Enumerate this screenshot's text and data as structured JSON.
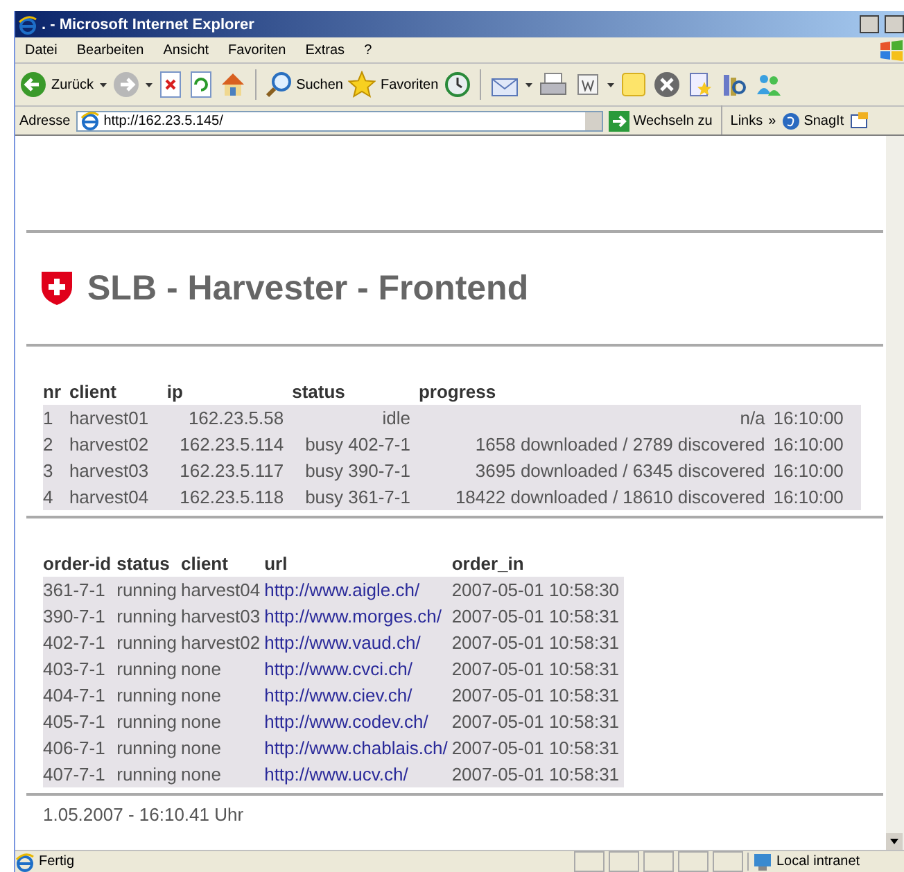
{
  "window": {
    "title": ". - Microsoft Internet Explorer"
  },
  "menu": [
    "Datei",
    "Bearbeiten",
    "Ansicht",
    "Favoriten",
    "Extras",
    "?"
  ],
  "toolbar": {
    "back_label": "Zurück",
    "search_label": "Suchen",
    "favorites_label": "Favoriten"
  },
  "address_bar": {
    "label": "Adresse",
    "url": "http://162.23.5.145/",
    "go": "Wechseln zu",
    "links": "Links",
    "more": "»",
    "snagit": "SnagIt"
  },
  "page": {
    "title": "SLB - Harvester - Frontend",
    "clients": {
      "columns": [
        "nr",
        "client",
        "ip",
        "status",
        "progress",
        ""
      ],
      "rows": [
        [
          "1",
          "harvest01",
          "162.23.5.58",
          "idle",
          "n/a",
          "16:10:00"
        ],
        [
          "2",
          "harvest02",
          "162.23.5.114",
          "busy 402-7-1",
          "1658 downloaded / 2789 discovered",
          "16:10:00"
        ],
        [
          "3",
          "harvest03",
          "162.23.5.117",
          "busy 390-7-1",
          "3695 downloaded / 6345 discovered",
          "16:10:00"
        ],
        [
          "4",
          "harvest04",
          "162.23.5.118",
          "busy 361-7-1",
          "18422 downloaded / 18610 discovered",
          "16:10:00"
        ]
      ]
    },
    "orders": {
      "columns": [
        "order-id",
        "status",
        "client",
        "url",
        "order_in"
      ],
      "rows": [
        [
          "361-7-1",
          "running",
          "harvest04",
          "http://www.aigle.ch/",
          "2007-05-01 10:58:30"
        ],
        [
          "390-7-1",
          "running",
          "harvest03",
          "http://www.morges.ch/",
          "2007-05-01 10:58:31"
        ],
        [
          "402-7-1",
          "running",
          "harvest02",
          "http://www.vaud.ch/",
          "2007-05-01 10:58:31"
        ],
        [
          "403-7-1",
          "running",
          "none",
          "http://www.cvci.ch/",
          "2007-05-01 10:58:31"
        ],
        [
          "404-7-1",
          "running",
          "none",
          "http://www.ciev.ch/",
          "2007-05-01 10:58:31"
        ],
        [
          "405-7-1",
          "running",
          "none",
          "http://www.codev.ch/",
          "2007-05-01 10:58:31"
        ],
        [
          "406-7-1",
          "running",
          "none",
          "http://www.chablais.ch/",
          "2007-05-01 10:58:31"
        ],
        [
          "407-7-1",
          "running",
          "none",
          "http://www.ucv.ch/",
          "2007-05-01 10:58:31"
        ]
      ]
    },
    "footer": "1.05.2007 - 16:10.41 Uhr"
  },
  "status_bar": {
    "text": "Fertig",
    "zone": "Local intranet"
  }
}
